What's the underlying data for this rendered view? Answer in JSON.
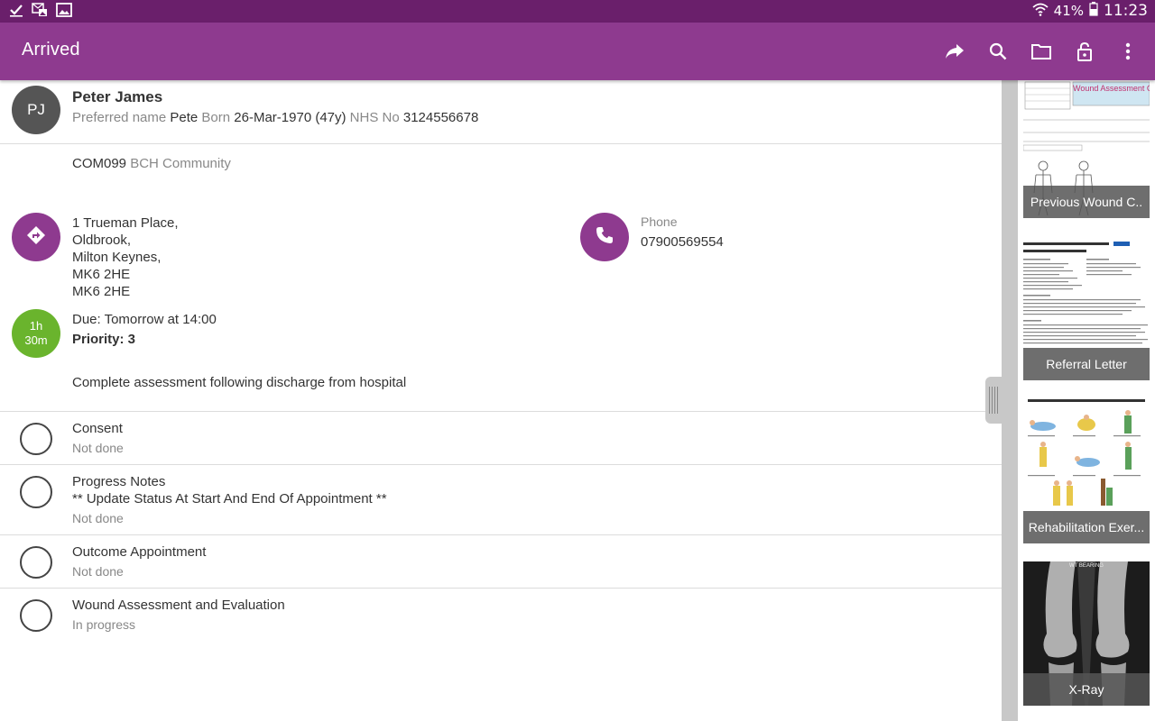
{
  "status_bar": {
    "battery": "41%",
    "time": "11:23",
    "icons": [
      "task-done-icon",
      "mail-image-icon",
      "image-icon",
      "wifi-icon",
      "battery-icon"
    ]
  },
  "app_bar": {
    "title": "Arrived",
    "actions": [
      "share-icon",
      "search-icon",
      "folder-icon",
      "lock-open-icon",
      "more-icon"
    ]
  },
  "patient": {
    "initials": "PJ",
    "name": "Peter James",
    "preferred_label": "Preferred name",
    "preferred_name": "Pete",
    "born_label": "Born",
    "born": "26-Mar-1970 (47y)",
    "nhs_label": "NHS No",
    "nhs_no": "3124556678"
  },
  "organisation": {
    "code": "COM099",
    "name": "BCH Community"
  },
  "address": {
    "lines": [
      "1 Trueman Place,",
      "Oldbrook,",
      "Milton Keynes,",
      "MK6 2HE",
      "MK6 2HE"
    ]
  },
  "phone": {
    "label": "Phone",
    "number": "07900569554"
  },
  "visit": {
    "duration_hours": "1h",
    "duration_minutes": "30m",
    "due": "Due: Tomorrow at 14:00",
    "priority": "Priority: 3",
    "description": "Complete assessment following discharge from hospital"
  },
  "tasks": [
    {
      "title": "Consent",
      "subtitle": "",
      "status": "Not done"
    },
    {
      "title": "Progress Notes",
      "subtitle": "**  Update Status At Start And End Of Appointment **",
      "status": "Not done"
    },
    {
      "title": "Outcome Appointment",
      "subtitle": "",
      "status": "Not done"
    },
    {
      "title": "Wound Assessment and Evaluation",
      "subtitle": "",
      "status": "In progress"
    }
  ],
  "attachments": [
    {
      "caption": "Previous Wound C..",
      "header": "Wound Assessment Char"
    },
    {
      "caption": "Referral Letter"
    },
    {
      "caption": "Rehabilitation Exer..."
    },
    {
      "caption": "X-Ray",
      "header": "WT BEARING"
    }
  ],
  "colors": {
    "status_bar": "#6a1f6b",
    "app_bar": "#8e3a8f",
    "accent": "#8e3a8f",
    "time_badge": "#6ab42d",
    "avatar": "#555555"
  }
}
